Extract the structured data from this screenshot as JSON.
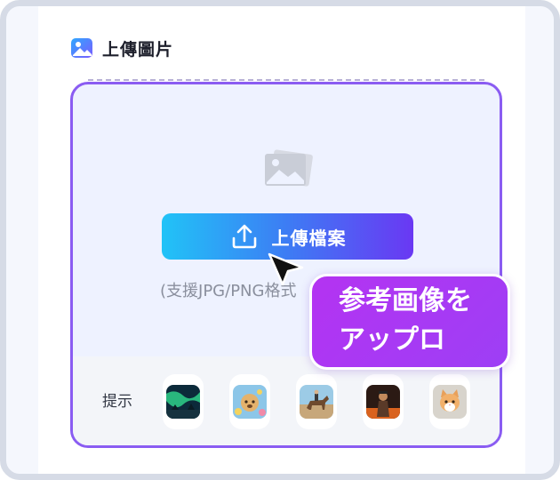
{
  "header": {
    "title": "上傳圖片",
    "icon": "image-icon"
  },
  "dropzone": {
    "upload_button_label": "上傳檔案",
    "upload_icon": "upload-icon",
    "formats_text": "(支援JPG/PNG格式",
    "border_color": "#8a5cf2"
  },
  "hints": {
    "label": "提示",
    "thumbnails": [
      {
        "name": "aurora-landscape"
      },
      {
        "name": "dog-with-flowers"
      },
      {
        "name": "person-on-horse"
      },
      {
        "name": "game-character"
      },
      {
        "name": "kitten"
      }
    ]
  },
  "tooltip": {
    "line1": "参考画像を",
    "line2": "アップロ"
  },
  "colors": {
    "accent": "#8a5cf2",
    "button_start": "#21c3f7",
    "button_end": "#6a38f3",
    "tooltip": "#b433f2"
  }
}
